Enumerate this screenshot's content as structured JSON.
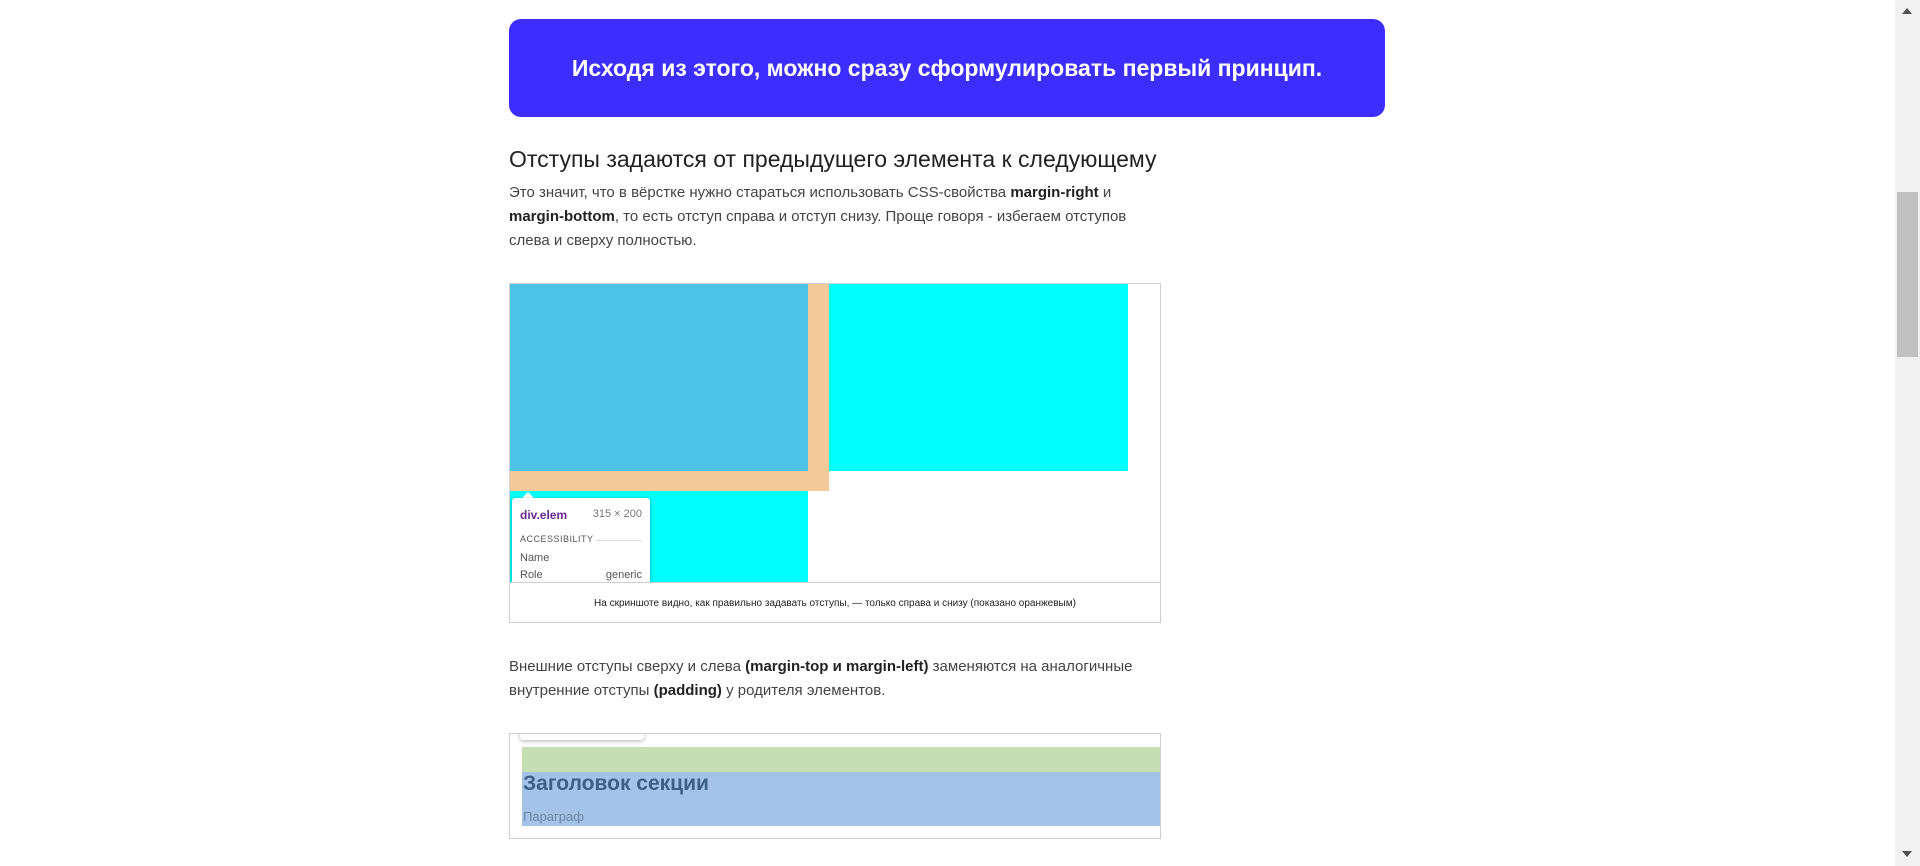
{
  "banner": {
    "text": "Исходя из этого, можно сразу сформулировать первый принцип."
  },
  "section_heading": "Отступы задаются от предыдущего элемента к следующему",
  "paragraph1": {
    "t1": "Это значит, что в вёрстке нужно стараться использовать CSS-свойства ",
    "b1": "margin-right",
    "t2": " и ",
    "b2": "margin-bottom",
    "t3": ", то есть отступ справа и отступ снизу. Проще говоря - избегаем отступов слева и сверху полностью."
  },
  "figure1": {
    "tooltip": {
      "selector": "div.elem",
      "dimensions": "315 × 200",
      "section": "ACCESSIBILITY",
      "name_label": "Name",
      "role_label": "Role",
      "role_value": "generic"
    },
    "caption": "На скриншоте видно, как правильно задавать отступы, — только справа и снизу (показано оранжевым)"
  },
  "paragraph2": {
    "t1": "Внешние отступы сверху и слева ",
    "b1": "(margin-top и margin-left)",
    "t2": " заменяются на аналогичные внутренние отступы ",
    "b2": "(padding)",
    "t3": " у родителя элементов."
  },
  "figure2": {
    "section_title": "Заголовок секции",
    "paragraph_label": "Параграф"
  },
  "colors": {
    "banner": "#3d2dff",
    "block_blue": "#4ac3e6",
    "block_cyan": "#00ffff",
    "margin_orange": "#f4c999"
  }
}
